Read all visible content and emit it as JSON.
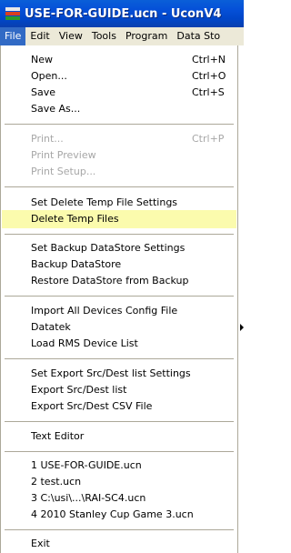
{
  "window": {
    "title": "USE-FOR-GUIDE.ucn - UconV4"
  },
  "menubar": {
    "items": [
      "File",
      "Edit",
      "View",
      "Tools",
      "Program",
      "Data Sto"
    ]
  },
  "file_menu": {
    "new": {
      "label": "New",
      "shortcut": "Ctrl+N"
    },
    "open": {
      "label": "Open...",
      "shortcut": "Ctrl+O"
    },
    "save": {
      "label": "Save",
      "shortcut": "Ctrl+S"
    },
    "save_as": {
      "label": "Save As..."
    },
    "print": {
      "label": "Print...",
      "shortcut": "Ctrl+P"
    },
    "print_preview": {
      "label": "Print Preview"
    },
    "print_setup": {
      "label": "Print Setup..."
    },
    "set_delete_temp": {
      "label": "Set Delete Temp File Settings"
    },
    "delete_temp": {
      "label": "Delete Temp Files"
    },
    "set_backup": {
      "label": "Set Backup DataStore Settings"
    },
    "backup": {
      "label": "Backup DataStore"
    },
    "restore": {
      "label": "Restore DataStore from Backup"
    },
    "import_all": {
      "label": "Import All Devices Config File"
    },
    "datatek": {
      "label": "Datatek"
    },
    "load_rms": {
      "label": "Load RMS Device List"
    },
    "set_export": {
      "label": "Set Export Src/Dest list Settings"
    },
    "export_list": {
      "label": "Export Src/Dest list"
    },
    "export_csv": {
      "label": "Export Src/Dest CSV File"
    },
    "text_editor": {
      "label": "Text Editor"
    },
    "recent": [
      "1 USE-FOR-GUIDE.ucn",
      "2 test.ucn",
      "3 C:\\usi\\...\\RAI-SC4.ucn",
      "4 2010 Stanley Cup Game 3.ucn"
    ],
    "exit": {
      "label": "Exit"
    }
  },
  "colors": {
    "titlebar": "#0550d8",
    "menu_active": "#316ac5",
    "highlight": "#fbfbad",
    "disabled_text": "#a7a7a7",
    "separator": "#aca899"
  }
}
